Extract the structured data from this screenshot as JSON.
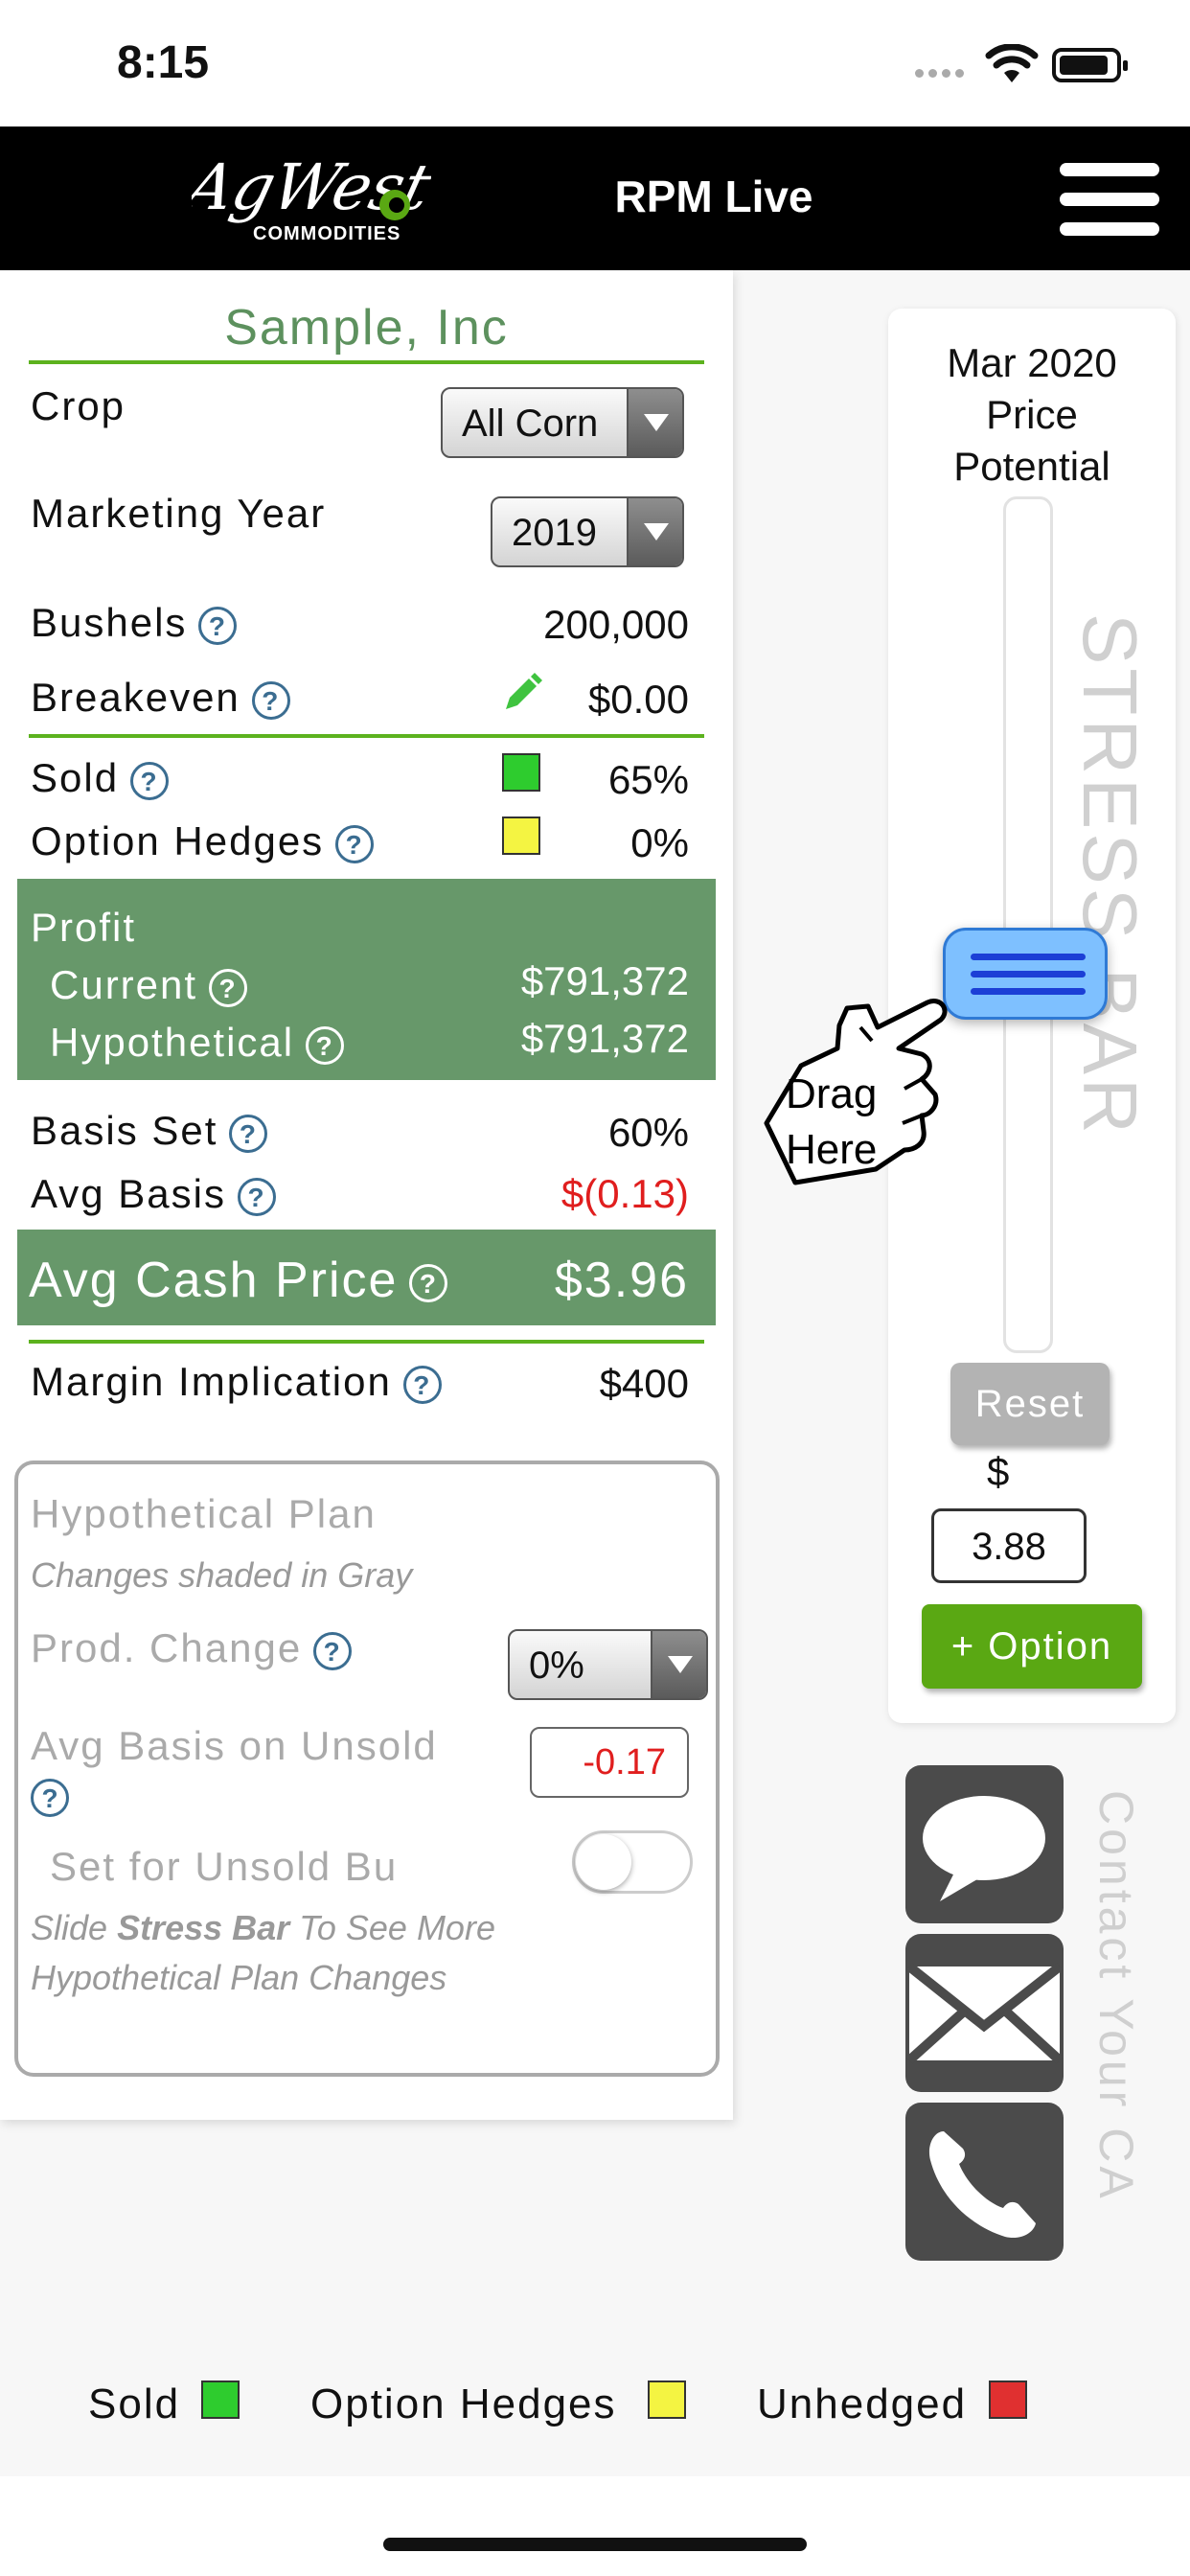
{
  "status": {
    "time": "8:15"
  },
  "header": {
    "title": "RPM Live",
    "logo_main": "AgWest",
    "logo_sub": "COMMODITIES"
  },
  "company": "Sample, Inc",
  "crop": {
    "label": "Crop",
    "value": "All Corn"
  },
  "marketing_year": {
    "label": "Marketing Year",
    "value": "2019"
  },
  "bushels": {
    "label": "Bushels",
    "value": "200,000"
  },
  "breakeven": {
    "label": "Breakeven",
    "value": "$0.00"
  },
  "sold": {
    "label": "Sold",
    "value": "65%",
    "color": "#2ecc2e"
  },
  "option_hedges": {
    "label": "Option Hedges",
    "value": "0%",
    "color": "#f4f442"
  },
  "profit": {
    "label": "Profit",
    "current_label": "Current",
    "current_value": "$791,372",
    "hypothetical_label": "Hypothetical",
    "hypothetical_value": "$791,372",
    "color": "#67986a"
  },
  "basis_set": {
    "label": "Basis Set",
    "value": "60%"
  },
  "avg_basis": {
    "label": "Avg Basis",
    "value": "$(0.13)",
    "color": "#e01e1e"
  },
  "avg_cash_price": {
    "label": "Avg Cash Price",
    "value": "$3.96"
  },
  "margin_implication": {
    "label": "Margin Implication",
    "value": "$400"
  },
  "hypothetical_plan": {
    "title": "Hypothetical Plan",
    "subtitle": "Changes shaded in Gray",
    "prod_change_label": "Prod. Change",
    "prod_change_value": "0%",
    "avg_basis_unsold_label": "Avg Basis on Unsold",
    "avg_basis_unsold_value": "-0.17",
    "set_unsold_label": "Set for Unsold Bu",
    "note_pre": "Slide ",
    "note_bold": "Stress Bar",
    "note_post": " To See More Hypothetical Plan Changes"
  },
  "stress_panel": {
    "title_line1": "Mar 2020",
    "title_line2": "Price",
    "title_line3": "Potential",
    "bar_text": "STRESS BAR",
    "drag_line1": "Drag",
    "drag_line2": "Here",
    "reset_label": "Reset",
    "currency": "$",
    "price_value": "3.88",
    "option_button": "+ Option"
  },
  "contact": {
    "label": "Contact Your CA"
  },
  "legend": [
    {
      "label": "Sold",
      "color": "#2ecc2e"
    },
    {
      "label": "Option Hedges",
      "color": "#f4f442"
    },
    {
      "label": "Unhedged",
      "color": "#e03030"
    }
  ]
}
